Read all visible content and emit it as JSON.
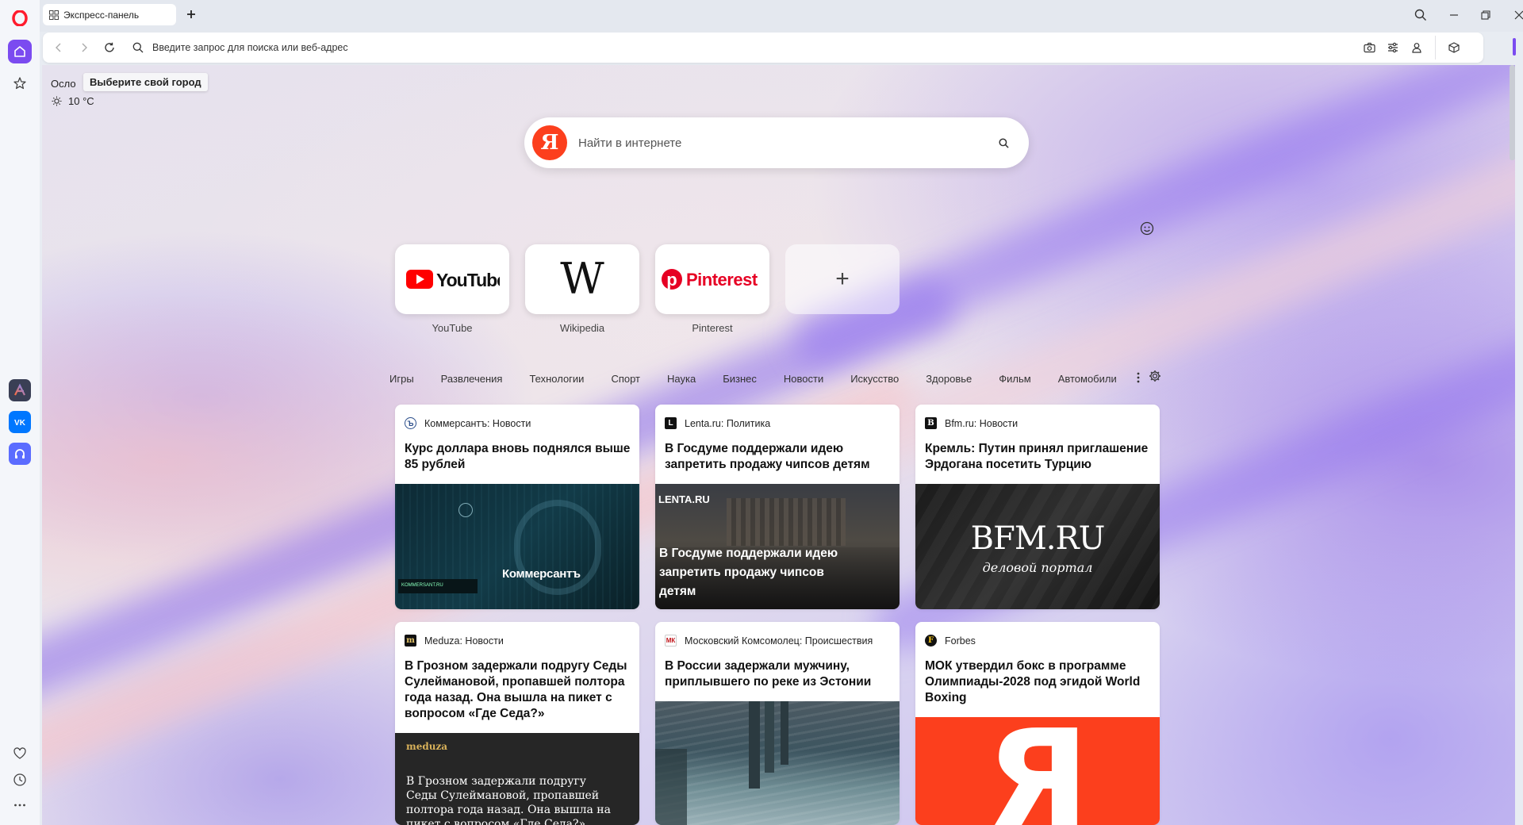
{
  "tab": {
    "title": "Экспресс-панель"
  },
  "address": {
    "placeholder": "Введите запрос для поиска или веб-адрес"
  },
  "weather": {
    "city": "Осло",
    "tooltip": "Выберите свой город",
    "temp": "10 °C"
  },
  "search": {
    "placeholder": "Найти в интернете",
    "logo": "Я"
  },
  "speed_dial": [
    {
      "label": "YouTube",
      "logo_text": "YouTube"
    },
    {
      "label": "Wikipedia",
      "logo_text": "W"
    },
    {
      "label": "Pinterest",
      "logo_text": "Pinterest"
    },
    {
      "label": "",
      "logo_text": "+"
    }
  ],
  "categories": [
    "Игры",
    "Развлечения",
    "Технологии",
    "Спорт",
    "Наука",
    "Бизнес",
    "Новости",
    "Искусство",
    "Здоровье",
    "Фильм",
    "Автомобили"
  ],
  "news": [
    {
      "source": "Коммерсантъ: Новости",
      "title": "Курс доллара вновь поднялся выше 85 рублей",
      "img_text": "Коммерсантъ",
      "img_sub": "KOMMERSANT.RU"
    },
    {
      "source": "Lenta.ru: Политика",
      "title": "В Госдуме поддержали идею запретить продажу чипсов детям",
      "img_text": "В Госдуме поддержали идею запретить продажу чипсов детям",
      "img_sub": "LENTA.RU"
    },
    {
      "source": "Bfm.ru: Новости",
      "title": "Кремль: Путин принял приглашение Эрдогана посетить Турцию",
      "img_text": "BFM.RU",
      "img_sub": "деловой портал"
    },
    {
      "source": "Meduza: Новости",
      "title": "В Грозном задержали подругу Седы Сулеймановой, пропавшей полтора года назад. Она вышла на пикет с вопросом «Где Седа?»",
      "img_text": "В Грозном задержали подругу Седы Сулеймановой, пропавшей полтора года назад. Она вышла на пикет с вопросом «Где Седа?»",
      "img_sub": "meduza"
    },
    {
      "source": "Московский Комсомолец: Происшествия",
      "title": "В России задержали мужчину, приплывшего по реке из Эстонии",
      "img_text": "",
      "img_sub": ""
    },
    {
      "source": "Forbes",
      "title": "МОК утвердил бокс в программе Олимпиады-2028 под эгидой World Boxing",
      "img_text": "Я",
      "img_sub": ""
    }
  ],
  "colors": {
    "accent": "#7b4bf0",
    "yandex_red": "#fc3f1d",
    "youtube_red": "#ff0000",
    "pinterest_red": "#e60023"
  }
}
